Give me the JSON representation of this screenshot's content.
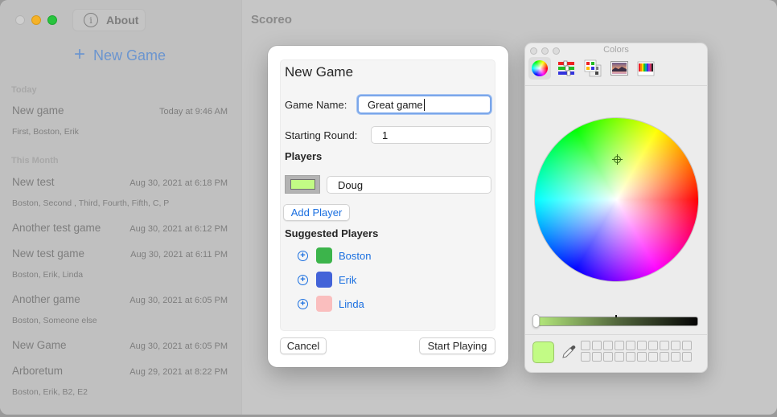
{
  "window": {
    "about_label": "About",
    "app_title": "Scoreo"
  },
  "sidebar": {
    "new_game_label": "New Game",
    "sections": [
      {
        "label": "Today",
        "games": [
          {
            "title": "New game",
            "date": "Today at 9:46 AM",
            "players": "First, Boston, Erik"
          }
        ]
      },
      {
        "label": "This Month",
        "games": [
          {
            "title": "New test",
            "date": "Aug 30, 2021 at 6:18 PM",
            "players": "Boston, Second , Third, Fourth, Fifth, C, P"
          },
          {
            "title": "Another test game",
            "date": "Aug 30, 2021 at 6:12 PM",
            "players": ""
          },
          {
            "title": "New test game",
            "date": "Aug 30, 2021 at 6:11 PM",
            "players": "Boston, Erik, Linda"
          },
          {
            "title": "Another game",
            "date": "Aug 30, 2021 at 6:05 PM",
            "players": "Boston, Someone else"
          },
          {
            "title": "New Game",
            "date": "Aug 30, 2021 at 6:05 PM",
            "players": ""
          },
          {
            "title": "Arboretum",
            "date": "Aug 29, 2021 at 8:22 PM",
            "players": "Boston, Erik, B2, E2"
          }
        ]
      }
    ]
  },
  "new_game_sheet": {
    "title": "New Game",
    "game_name_label": "Game Name:",
    "game_name_value": "Great game",
    "starting_round_label": "Starting Round:",
    "starting_round_value": "1",
    "players_heading": "Players",
    "players": [
      {
        "name": "Doug",
        "color": "#c2fb85"
      }
    ],
    "add_player_label": "Add Player",
    "suggested_heading": "Suggested Players",
    "suggested_players": [
      {
        "name": "Boston",
        "color": "#3cb44b"
      },
      {
        "name": "Erik",
        "color": "#4363d8"
      },
      {
        "name": "Linda",
        "color": "#fabebe"
      }
    ],
    "cancel_label": "Cancel",
    "start_label": "Start Playing"
  },
  "colors_panel": {
    "title": "Colors",
    "modes": [
      {
        "name": "color-wheel",
        "active": true
      },
      {
        "name": "color-sliders",
        "active": false
      },
      {
        "name": "color-palettes",
        "active": false
      },
      {
        "name": "image-palettes",
        "active": false
      },
      {
        "name": "pencils",
        "active": false
      }
    ],
    "current_color": "#c2fb85",
    "brightness": 1.0
  },
  "colors": {
    "accent": "#1a6fe0",
    "focus_ring": "#7aa6ea"
  }
}
